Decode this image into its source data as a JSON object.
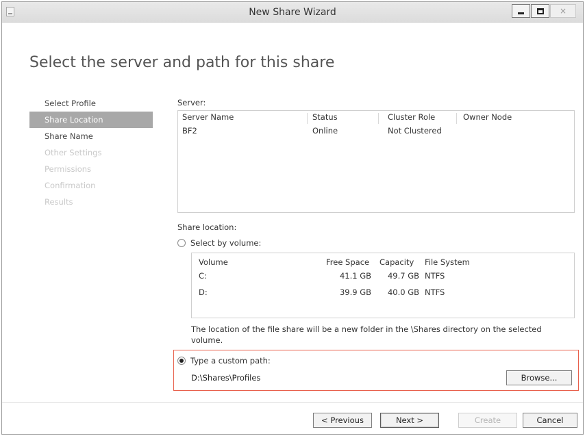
{
  "window": {
    "title": "New Share Wizard",
    "close_glyph": "×"
  },
  "page": {
    "heading": "Select the server and path for this share"
  },
  "nav": {
    "items": [
      {
        "label": "Select Profile",
        "state": "normal"
      },
      {
        "label": "Share Location",
        "state": "active"
      },
      {
        "label": "Share Name",
        "state": "normal"
      },
      {
        "label": "Other Settings",
        "state": "disabled"
      },
      {
        "label": "Permissions",
        "state": "disabled"
      },
      {
        "label": "Confirmation",
        "state": "disabled"
      },
      {
        "label": "Results",
        "state": "disabled"
      }
    ]
  },
  "server": {
    "label": "Server:",
    "columns": [
      "Server Name",
      "Status",
      "Cluster Role",
      "Owner Node"
    ],
    "rows": [
      [
        "BF2",
        "Online",
        "Not Clustered",
        ""
      ]
    ]
  },
  "share_location": {
    "label": "Share location:",
    "select_by_volume_label": "Select by volume:",
    "volume_columns": [
      "Volume",
      "Free Space",
      "Capacity",
      "File System"
    ],
    "volumes": [
      [
        "C:",
        "41.1 GB",
        "49.7 GB",
        "NTFS"
      ],
      [
        "D:",
        "39.9 GB",
        "40.0 GB",
        "NTFS"
      ]
    ],
    "info": "The location of the file share will be a new folder in the \\Shares directory on the selected volume.",
    "custom_path_label": "Type a custom path:",
    "custom_path_value": "D:\\Shares\\Profiles",
    "browse_label": "Browse..."
  },
  "footer": {
    "previous_label": "< Previous",
    "next_label": "Next >",
    "create_label": "Create",
    "cancel_label": "Cancel"
  },
  "colors": {
    "highlight": "#e8604c",
    "nav_active_bg": "#a8a8a8"
  }
}
